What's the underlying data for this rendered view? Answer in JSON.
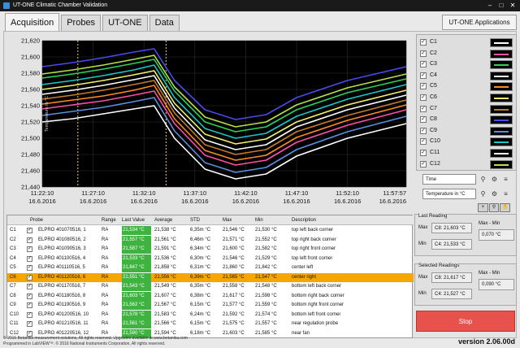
{
  "window": {
    "title": "UT-ONE Climatic Chamber Validation",
    "minimize": "–",
    "maximize": "□",
    "close": "✕"
  },
  "tabs": [
    "Acquisition",
    "Probes",
    "UT-ONE",
    "Data"
  ],
  "applications_button": "UT-ONE Applications",
  "chart_data": {
    "type": "line",
    "ylabel": "Temperature in °C",
    "ylim": [
      21.44,
      21.62
    ],
    "yticks": [
      "21,620",
      "21,600",
      "21,580",
      "21,560",
      "21,540",
      "21,520",
      "21,500",
      "21,480",
      "21,460",
      "21,440"
    ],
    "xticks": [
      {
        "time": "11:22:10",
        "date": "16.6.2016"
      },
      {
        "time": "11:27:10",
        "date": "16.6.2016"
      },
      {
        "time": "11:32:10",
        "date": "16.6.2016"
      },
      {
        "time": "11:37:10",
        "date": "16.6.2016"
      },
      {
        "time": "11:42:10",
        "date": "16.6.2016"
      },
      {
        "time": "11:47:10",
        "date": "16.6.2016"
      },
      {
        "time": "11:52:10",
        "date": "16.6.2016"
      },
      {
        "time": "11:57:57",
        "date": "16.6.2016"
      }
    ],
    "cursors": [
      "11:25:40",
      "11:34:20"
    ],
    "x_minutes": [
      0,
      3,
      6,
      9,
      11,
      13,
      16,
      19,
      22,
      25,
      30,
      35.78
    ],
    "background": "#000000",
    "series": [
      {
        "color": "#ffffff",
        "values": [
          21.52,
          21.524,
          21.53,
          21.536,
          21.54,
          21.5,
          21.462,
          21.45,
          21.456,
          21.478,
          21.5,
          21.518
        ]
      },
      {
        "color": "#5a8fe0",
        "values": [
          21.528,
          21.533,
          21.538,
          21.545,
          21.55,
          21.509,
          21.47,
          21.458,
          21.464,
          21.486,
          21.508,
          21.527
        ]
      },
      {
        "color": "#ff4fa8",
        "values": [
          21.536,
          21.541,
          21.546,
          21.553,
          21.558,
          21.518,
          21.479,
          21.467,
          21.473,
          21.495,
          21.516,
          21.535
        ]
      },
      {
        "color": "#ff8a1e",
        "values": [
          21.542,
          21.547,
          21.552,
          21.559,
          21.565,
          21.524,
          21.485,
          21.473,
          21.479,
          21.501,
          21.522,
          21.541
        ]
      },
      {
        "color": "#c27c2c",
        "values": [
          21.548,
          21.553,
          21.559,
          21.566,
          21.571,
          21.531,
          21.492,
          21.48,
          21.486,
          21.508,
          21.528,
          21.547
        ]
      },
      {
        "color": "#ffffff",
        "values": [
          21.554,
          21.559,
          21.565,
          21.572,
          21.577,
          21.537,
          21.498,
          21.486,
          21.492,
          21.514,
          21.535,
          21.553
        ]
      },
      {
        "color": "#f5f06a",
        "values": [
          21.56,
          21.565,
          21.571,
          21.578,
          21.583,
          21.543,
          21.505,
          21.493,
          21.499,
          21.52,
          21.541,
          21.559
        ]
      },
      {
        "color": "#19c8c8",
        "values": [
          21.566,
          21.571,
          21.577,
          21.584,
          21.59,
          21.55,
          21.512,
          21.5,
          21.506,
          21.527,
          21.548,
          21.566
        ]
      },
      {
        "color": "#2fd15a",
        "values": [
          21.574,
          21.579,
          21.585,
          21.592,
          21.597,
          21.558,
          21.52,
          21.508,
          21.514,
          21.535,
          21.556,
          21.573
        ]
      },
      {
        "color": "#b8e04a",
        "values": [
          21.579,
          21.584,
          21.59,
          21.597,
          21.602,
          21.563,
          21.526,
          21.514,
          21.52,
          21.541,
          21.562,
          21.579
        ]
      },
      {
        "color": "#4a4af0",
        "values": [
          21.588,
          21.593,
          21.599,
          21.606,
          21.61,
          21.571,
          21.535,
          21.523,
          21.529,
          21.55,
          21.571,
          21.588
        ]
      }
    ]
  },
  "legend": [
    {
      "label": "C1",
      "checked": true,
      "color": "#ffffff"
    },
    {
      "label": "C2",
      "checked": true,
      "color": "#ff4fa8"
    },
    {
      "label": "C3",
      "checked": true,
      "color": "#2fd15a"
    },
    {
      "label": "C4",
      "checked": true,
      "color": "#ffffff"
    },
    {
      "label": "C5",
      "checked": true,
      "color": "#ff8a1e"
    },
    {
      "label": "C6",
      "checked": true,
      "color": "#f5f06a"
    },
    {
      "label": "C7",
      "checked": true,
      "color": "#c27c2c"
    },
    {
      "label": "C8",
      "checked": true,
      "color": "#4a4af0"
    },
    {
      "label": "C9",
      "checked": true,
      "color": "#5a8fe0"
    },
    {
      "label": "C10",
      "checked": true,
      "color": "#19c8c8"
    },
    {
      "label": "C11",
      "checked": true,
      "color": "#ffffff"
    },
    {
      "label": "C12",
      "checked": true,
      "color": "#b8e04a"
    }
  ],
  "axis_controls": {
    "x_label": "Time",
    "y_label": "Temperature in °C"
  },
  "table": {
    "headers": [
      "Probe",
      "Range",
      "Last Value",
      "Average",
      "STD",
      "Max",
      "Min",
      "Description"
    ],
    "rows": [
      {
        "id": "C1",
        "probe": "ELPRO 401070516, 1",
        "range": "RA",
        "last": "21,534 °C",
        "avg": "21,538 °C",
        "std": "6,35m °C",
        "max": "21,546 °C",
        "min": "21,530 °C",
        "desc": "top left back corner",
        "selected": false
      },
      {
        "id": "C2",
        "probe": "ELPRO 401080516, 2",
        "range": "RA",
        "last": "21,557 °C",
        "avg": "21,561 °C",
        "std": "6,46m °C",
        "max": "21,571 °C",
        "min": "21,552 °C",
        "desc": "top right back corner",
        "selected": false
      },
      {
        "id": "C3",
        "probe": "ELPRO 401090516, 3",
        "range": "RA",
        "last": "21,587 °C",
        "avg": "21,591 °C",
        "std": "6,34m °C",
        "max": "21,600 °C",
        "min": "21,582 °C",
        "desc": "top right front corner",
        "selected": false
      },
      {
        "id": "C4",
        "probe": "ELPRO 401100516, 4",
        "range": "RA",
        "last": "21,533 °C",
        "avg": "21,536 °C",
        "std": "6,30m °C",
        "max": "21,546 °C",
        "min": "21,529 °C",
        "desc": "top left front corner",
        "selected": false
      },
      {
        "id": "C5",
        "probe": "ELPRO 401110516, 5",
        "range": "RA",
        "last": "21,847 °C",
        "avg": "21,858 °C",
        "std": "6,31m °C",
        "max": "21,860 °C",
        "min": "21,842 °C",
        "desc": "center left",
        "selected": false
      },
      {
        "id": "C6",
        "probe": "ELPRO 401120516, 6",
        "range": "RA",
        "last": "21,551 °C",
        "avg": "21,556 °C",
        "std": "6,39m °C",
        "max": "21,565 °C",
        "min": "21,547 °C",
        "desc": "center right",
        "selected": true
      },
      {
        "id": "C7",
        "probe": "ELPRO 401170516, 7",
        "range": "RA",
        "last": "21,543 °C",
        "avg": "21,549 °C",
        "std": "6,35m °C",
        "max": "21,558 °C",
        "min": "21,548 °C",
        "desc": "bottom left back corner",
        "selected": false
      },
      {
        "id": "C8",
        "probe": "ELPRO 401180516, 8",
        "range": "RA",
        "last": "21,603 °C",
        "avg": "21,607 °C",
        "std": "6,38m °C",
        "max": "21,617 °C",
        "min": "21,598 °C",
        "desc": "bottom right back corner",
        "selected": false
      },
      {
        "id": "C9",
        "probe": "ELPRO 401190516, 9",
        "range": "RA",
        "last": "21,562 °C",
        "avg": "21,567 °C",
        "std": "6,15m °C",
        "max": "21,577 °C",
        "min": "21,559 °C",
        "desc": "bottom right front corner",
        "selected": false
      },
      {
        "id": "C10",
        "probe": "ELPRO 401200516, 10",
        "range": "RA",
        "last": "21,578 °C",
        "avg": "21,583 °C",
        "std": "6,24m °C",
        "max": "21,592 °C",
        "min": "21,574 °C",
        "desc": "bottom left front corner",
        "selected": false
      },
      {
        "id": "C11",
        "probe": "ELPRO 401210516, 11",
        "range": "RA",
        "last": "21,561 °C",
        "avg": "21,566 °C",
        "std": "6,15m °C",
        "max": "21,575 °C",
        "min": "21,557 °C",
        "desc": "near regulation probe",
        "selected": false
      },
      {
        "id": "C12",
        "probe": "ELPRO 401220516, 12",
        "range": "RA",
        "last": "21,590 °C",
        "avg": "21,594 °C",
        "std": "6,18m °C",
        "max": "21,603 °C",
        "min": "21,585 °C",
        "desc": "near fan",
        "selected": false
      }
    ]
  },
  "last_reading": {
    "title": "Last Reading",
    "max_label": "Max",
    "max_value": "C8: 21,603 °C",
    "min_label": "Min",
    "min_value": "C4: 21,533 °C",
    "diff_label": "Max - Min",
    "diff_value": "0,070 °C"
  },
  "selected_readings": {
    "title": "Selected Readings",
    "max_label": "Max",
    "max_value": "C8: 21,617 °C",
    "min_label": "Min",
    "min_value": "C4: 21,527 °C",
    "diff_label": "Max - Min",
    "diff_value": "0,090 °C"
  },
  "stop_button": "Stop",
  "footer": {
    "line1": "© 2016 Betanika measurement solutions, All rights reserved. Upgrades available at www.betanika.com",
    "line2": "Programmed in LabVIEW™. © 2016 National Instruments Corporation, All rights reserved."
  },
  "version": "version 2.06.00d"
}
